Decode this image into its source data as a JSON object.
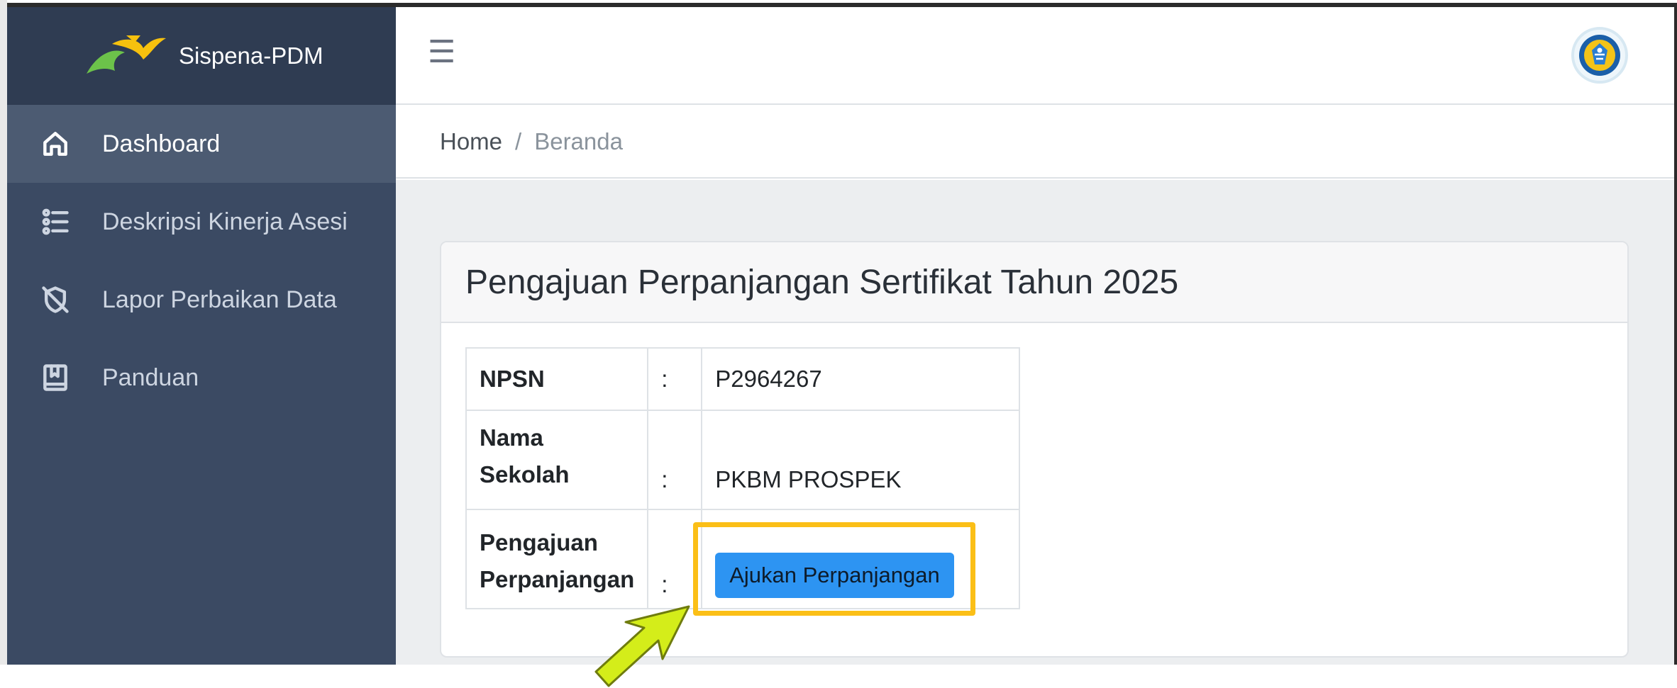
{
  "brand": {
    "name": "Sispena-PDM",
    "logo": "sispena-logo"
  },
  "sidebar": {
    "items": [
      {
        "label": "Dashboard",
        "icon": "home-icon",
        "active": true
      },
      {
        "label": "Deskripsi Kinerja Asesi",
        "icon": "list-icon",
        "active": false
      },
      {
        "label": "Lapor Perbaikan Data",
        "icon": "shield-off-icon",
        "active": false
      },
      {
        "label": "Panduan",
        "icon": "book-icon",
        "active": false
      }
    ]
  },
  "topbar": {
    "menu_icon": "hamburger-icon",
    "avatar": "kemendikbud-emblem"
  },
  "breadcrumb": {
    "home": "Home",
    "separator": "/",
    "current": "Beranda"
  },
  "card": {
    "title": "Pengajuan Perpanjangan Sertifikat Tahun 2025",
    "rows": [
      {
        "label": "NPSN",
        "colon": ":",
        "value": "P2964267"
      },
      {
        "label_line1": "Nama",
        "label_line2": "Sekolah",
        "colon": ":",
        "value": "PKBM PROSPEK"
      },
      {
        "label_line1": "Pengajuan",
        "label_line2": "Perpanjangan",
        "colon": ":",
        "button": "Ajukan Perpanjangan"
      }
    ]
  },
  "colors": {
    "sidebar_bg": "#3b4a63",
    "sidebar_brand_bg": "#2f3c52",
    "active_item_bg": "#4c5b72",
    "button_bg": "#2d94f2",
    "highlight": "#fbbf17",
    "arrow": "#d4ed1a"
  }
}
